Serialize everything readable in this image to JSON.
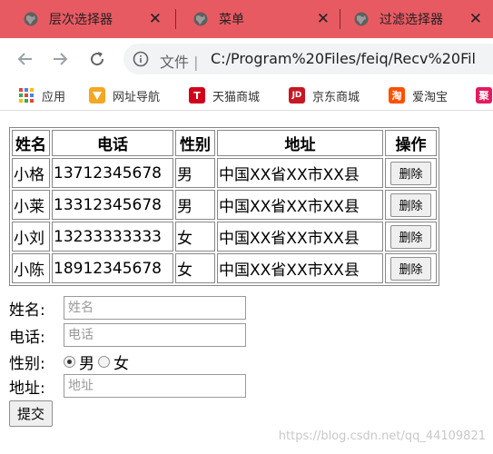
{
  "browser": {
    "tabs": [
      {
        "title": "层次选择器",
        "close": "✕"
      },
      {
        "title": "菜单",
        "close": "✕"
      },
      {
        "title": "过滤选择器",
        "close": "✕"
      }
    ],
    "address": {
      "file_label": "文件",
      "separator": "|",
      "url": "C:/Program%20Files/feiq/Recv%20Fil"
    },
    "bookmarks": [
      {
        "label": "应用",
        "icon": "apps-grid-icon"
      },
      {
        "label": "网址导航",
        "icon": "nav-arrow-icon",
        "color": "#f5a623"
      },
      {
        "label": "天猫商城",
        "icon": "tmall-icon",
        "color": "#d0021b",
        "glyph": "T"
      },
      {
        "label": "京东商城",
        "icon": "jd-icon",
        "color": "#c81623",
        "glyph": "JD"
      },
      {
        "label": "爱淘宝",
        "icon": "taobao-icon",
        "color": "#ff5000",
        "glyph": "淘"
      },
      {
        "label": "",
        "icon": "ju-icon",
        "color": "#e5195e",
        "glyph": "聚"
      }
    ]
  },
  "table": {
    "headers": [
      "姓名",
      "电话",
      "性别",
      "地址",
      "操作"
    ],
    "rows": [
      {
        "name": "小格",
        "phone": "13712345678",
        "gender": "男",
        "address": "中国XX省XX市XX县",
        "action": "删除"
      },
      {
        "name": "小莱",
        "phone": "13312345678",
        "gender": "男",
        "address": "中国XX省XX市XX县",
        "action": "删除"
      },
      {
        "name": "小刘",
        "phone": "13233333333",
        "gender": "女",
        "address": "中国XX省XX市XX县",
        "action": "删除"
      },
      {
        "name": "小陈",
        "phone": "18912345678",
        "gender": "女",
        "address": "中国XX省XX市XX县",
        "action": "删除"
      }
    ]
  },
  "form": {
    "name_label": "姓名:",
    "name_placeholder": "姓名",
    "phone_label": "电话:",
    "phone_placeholder": "电话",
    "gender_label": "性别:",
    "gender_options": [
      "男",
      "女"
    ],
    "gender_selected": "男",
    "address_label": "地址:",
    "address_placeholder": "地址",
    "submit_label": "提交"
  },
  "watermark": "https://blog.csdn.net/qq_44109821",
  "colors": {
    "tab_bar": "#e85a62",
    "omnibox": "#f1f3f4"
  }
}
